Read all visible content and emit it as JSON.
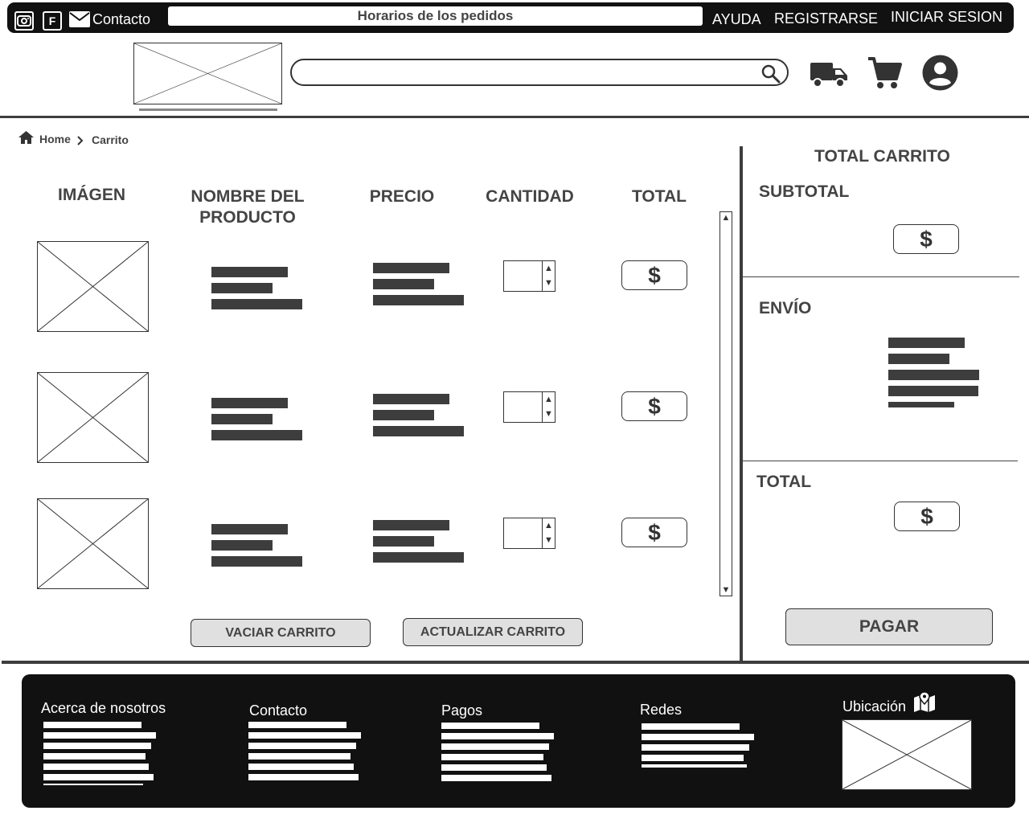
{
  "topbar": {
    "social": [
      {
        "icon": "instagram-icon"
      },
      {
        "icon": "facebook-icon",
        "glyph": "F"
      }
    ],
    "contact_label": "Contacto",
    "orders_label": "Horarios de los pedidos",
    "help_label": "AYUDA",
    "register_label": "REGISTRARSE",
    "login_label": "INICIAR SESION"
  },
  "header": {
    "search": {
      "value": "",
      "placeholder": ""
    },
    "icons": [
      "truck-icon",
      "cart-icon",
      "user-account-icon"
    ]
  },
  "breadcrumb": {
    "home": "Home",
    "current": "Carrito"
  },
  "cart": {
    "headers": {
      "image": "IMÁGEN",
      "name": "NOMBRE DEL PRODUCTO",
      "price": "PRECIO",
      "quantity": "CANTIDAD",
      "total": "TOTAL"
    },
    "rows": [
      {
        "money": "$",
        "qty_up": "▲",
        "qty_down": "▼"
      },
      {
        "money": "$",
        "qty_up": "▲",
        "qty_down": "▼"
      },
      {
        "money": "$",
        "qty_up": "▲",
        "qty_down": "▼"
      }
    ],
    "scroll_up": "▲",
    "scroll_down": "▼",
    "empty_button": "VACIAR CARRITO",
    "update_button": "ACTUALIZAR CARRITO"
  },
  "summary": {
    "title": "TOTAL CARRITO",
    "subtotal_label": "SUBTOTAL",
    "subtotal_value": "$",
    "shipping_label": "ENVÍO",
    "total_label": "TOTAL",
    "total_value": "$",
    "pay_button": "PAGAR"
  },
  "footer": {
    "about": "Acerca de nosotros",
    "contact": "Contacto",
    "payments": "Pagos",
    "social": "Redes",
    "location": "Ubicación"
  },
  "colors": {
    "dark": "#111111",
    "bar": "#3d3d3d",
    "button": "#e0e0e0"
  }
}
